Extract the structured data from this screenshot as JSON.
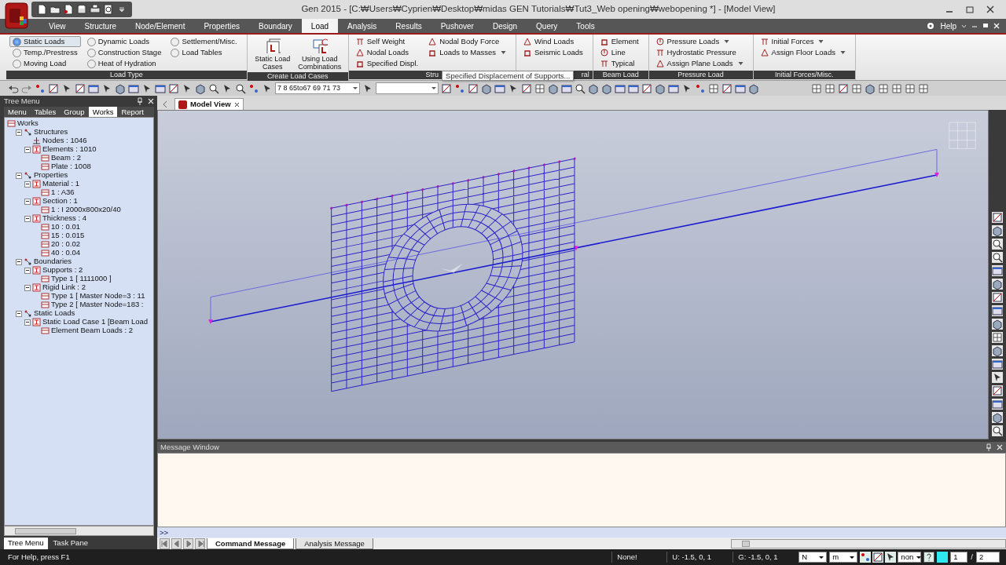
{
  "window": {
    "title": "Gen 2015 - [C:₩Users₩Cyprien₩Desktop₩midas GEN Tutorials₩Tut3_Web opening₩webopening *] - [Model View]"
  },
  "menu_tabs": [
    {
      "label": "View",
      "selected": false
    },
    {
      "label": "Structure",
      "selected": false
    },
    {
      "label": "Node/Element",
      "selected": false
    },
    {
      "label": "Properties",
      "selected": false
    },
    {
      "label": "Boundary",
      "selected": false
    },
    {
      "label": "Load",
      "selected": true
    },
    {
      "label": "Analysis",
      "selected": false
    },
    {
      "label": "Results",
      "selected": false
    },
    {
      "label": "Pushover",
      "selected": false
    },
    {
      "label": "Design",
      "selected": false
    },
    {
      "label": "Query",
      "selected": false
    },
    {
      "label": "Tools",
      "selected": false
    }
  ],
  "help": {
    "label": "Help"
  },
  "ribbon_groups": [
    {
      "title": "Load Type",
      "columns": [
        {
          "items": [
            {
              "kind": "radio",
              "label": "Static Loads",
              "selected": true
            },
            {
              "kind": "radio",
              "label": "Temp./Prestress",
              "selected": false
            },
            {
              "kind": "radio",
              "label": "Moving Load",
              "selected": false
            }
          ]
        },
        {
          "items": [
            {
              "kind": "radio",
              "label": "Dynamic Loads",
              "selected": false
            },
            {
              "kind": "radio",
              "label": "Construction Stage",
              "selected": false
            },
            {
              "kind": "radio",
              "label": "Heat of Hydration",
              "selected": false
            }
          ]
        },
        {
          "items": [
            {
              "kind": "radio",
              "label": "Settlement/Misc.",
              "selected": false
            },
            {
              "kind": "radio",
              "label": "Load Tables",
              "selected": false
            }
          ]
        }
      ]
    },
    {
      "title": "Create Load Cases",
      "columns": [
        {
          "items": [
            {
              "kind": "large_button",
              "label": "Static Load Cases"
            }
          ]
        },
        {
          "items": [
            {
              "kind": "large_button",
              "label": "Using Load Combinations"
            }
          ]
        }
      ]
    },
    {
      "title": "Stru",
      "columns": [
        {
          "items": [
            {
              "kind": "button",
              "label": "Self Weight",
              "dropdown": false
            },
            {
              "kind": "button",
              "label": "Nodal Loads",
              "dropdown": false
            },
            {
              "kind": "button",
              "label": "Specified Displ.",
              "dropdown": false
            }
          ]
        },
        {
          "items": [
            {
              "kind": "button",
              "label": "Nodal Body Force",
              "dropdown": false
            },
            {
              "kind": "button",
              "label": "Loads to Masses",
              "dropdown": true
            }
          ]
        }
      ]
    },
    {
      "title": "ral",
      "columns": [
        {
          "items": [
            {
              "kind": "button",
              "label": "Wind Loads",
              "dropdown": false
            },
            {
              "kind": "button",
              "label": "Seismic Loads",
              "dropdown": false
            }
          ]
        }
      ]
    },
    {
      "title": "Beam Load",
      "columns": [
        {
          "items": [
            {
              "kind": "button",
              "label": "Element",
              "dropdown": false
            },
            {
              "kind": "button",
              "label": "Line",
              "dropdown": false
            },
            {
              "kind": "button",
              "label": "Typical",
              "dropdown": false
            }
          ]
        }
      ]
    },
    {
      "title": "Pressure Load",
      "columns": [
        {
          "items": [
            {
              "kind": "button",
              "label": "Pressure Loads",
              "dropdown": true
            },
            {
              "kind": "button",
              "label": "Hydrostatic Pressure",
              "dropdown": false
            },
            {
              "kind": "button",
              "label": "Assign Plane Loads",
              "dropdown": true
            }
          ]
        }
      ]
    },
    {
      "title": "Initial Forces/Misc.",
      "columns": [
        {
          "items": [
            {
              "kind": "button",
              "label": "Initial Forces",
              "dropdown": true
            },
            {
              "kind": "button",
              "label": "Assign Floor Loads",
              "dropdown": true
            }
          ]
        }
      ]
    }
  ],
  "tooltip": {
    "text": "Specified Displacement of Supports..."
  },
  "toolbar": {
    "selection_field": "7 8 65to67 69 71 73"
  },
  "tree_panel": {
    "title": "Tree Menu",
    "tabs": [
      {
        "label": "Menu",
        "selected": false
      },
      {
        "label": "Tables",
        "selected": false
      },
      {
        "label": "Group",
        "selected": false
      },
      {
        "label": "Works",
        "selected": true
      },
      {
        "label": "Report",
        "selected": false
      }
    ],
    "tree": [
      {
        "label": "Works",
        "expanded": true,
        "children": [
          {
            "label": "Structures",
            "expanded": true,
            "children": [
              {
                "label": "Nodes : 1046"
              },
              {
                "label": "Elements : 1010",
                "expanded": true,
                "children": [
                  {
                    "label": "Beam : 2"
                  },
                  {
                    "label": "Plate : 1008"
                  }
                ]
              }
            ]
          },
          {
            "label": "Properties",
            "expanded": true,
            "children": [
              {
                "label": "Material : 1",
                "expanded": true,
                "children": [
                  {
                    "label": "1 : A36"
                  }
                ]
              },
              {
                "label": "Section : 1",
                "expanded": true,
                "children": [
                  {
                    "label": "1 : I 2000x800x20/40"
                  }
                ]
              },
              {
                "label": "Thickness : 4",
                "expanded": true,
                "children": [
                  {
                    "label": "10 : 0.01"
                  },
                  {
                    "label": "15 : 0.015"
                  },
                  {
                    "label": "20 : 0.02"
                  },
                  {
                    "label": "40 : 0.04"
                  }
                ]
              }
            ]
          },
          {
            "label": "Boundaries",
            "expanded": true,
            "children": [
              {
                "label": "Supports : 2",
                "expanded": true,
                "children": [
                  {
                    "label": "Type 1 [ 1111000 ]"
                  }
                ]
              },
              {
                "label": "Rigid Link : 2",
                "expanded": true,
                "children": [
                  {
                    "label": "Type 1 [ Master Node=3 : 11"
                  },
                  {
                    "label": "Type 2 [ Master Node=183 :"
                  }
                ]
              }
            ]
          },
          {
            "label": "Static Loads",
            "expanded": true,
            "children": [
              {
                "label": "Static Load Case 1 [Beam Load",
                "expanded": true,
                "children": [
                  {
                    "label": "Element Beam Loads : 2"
                  }
                ]
              }
            ]
          }
        ]
      }
    ],
    "bottom_tabs": [
      {
        "label": "Tree Menu",
        "selected": true
      },
      {
        "label": "Task Pane",
        "selected": false
      }
    ]
  },
  "model_view": {
    "tab": "Model View"
  },
  "message_window": {
    "title": "Message Window",
    "prompt": ">>",
    "tabs": [
      {
        "label": "Command Message",
        "selected": true
      },
      {
        "label": "Analysis Message",
        "selected": false
      }
    ]
  },
  "status_bar": {
    "help_text": "For Help, press F1",
    "selection": "None!",
    "u_coord": "U: -1.5, 0, 1",
    "g_coord": "G: -1.5, 0, 1",
    "force_unit": "N",
    "length_unit": "m",
    "dropdown_3": "non",
    "page": "1",
    "separator": "/",
    "page_total": "2"
  }
}
